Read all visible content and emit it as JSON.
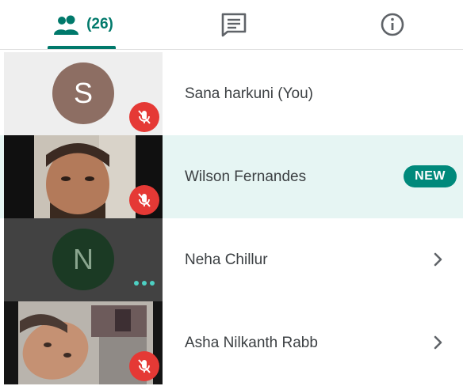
{
  "tabs": {
    "people": {
      "icon": "people-icon",
      "count_label": "(26)"
    },
    "chat": {
      "icon": "chat-icon"
    },
    "info": {
      "icon": "info-icon"
    },
    "accent_color": "#00796b"
  },
  "participants": [
    {
      "name": "Sana harkuni (You)",
      "avatar_letter": "S",
      "avatar_color": "#8d6e63",
      "mic_muted": true,
      "highlighted": false
    },
    {
      "name": "Wilson Fernandes",
      "video": true,
      "mic_muted": true,
      "badge": "NEW",
      "highlighted": true
    },
    {
      "name": "Neha Chillur",
      "avatar_letter": "N",
      "avatar_color": "#1b3a24",
      "speaking_indicator": true,
      "highlighted": false
    },
    {
      "name": "Asha Nilkanth Rabb",
      "video": true,
      "mic_muted": true,
      "highlighted": false
    }
  ],
  "colors": {
    "highlight_row": "#e6f5f3",
    "muted_badge": "#e53935",
    "new_badge": "#00897b"
  }
}
